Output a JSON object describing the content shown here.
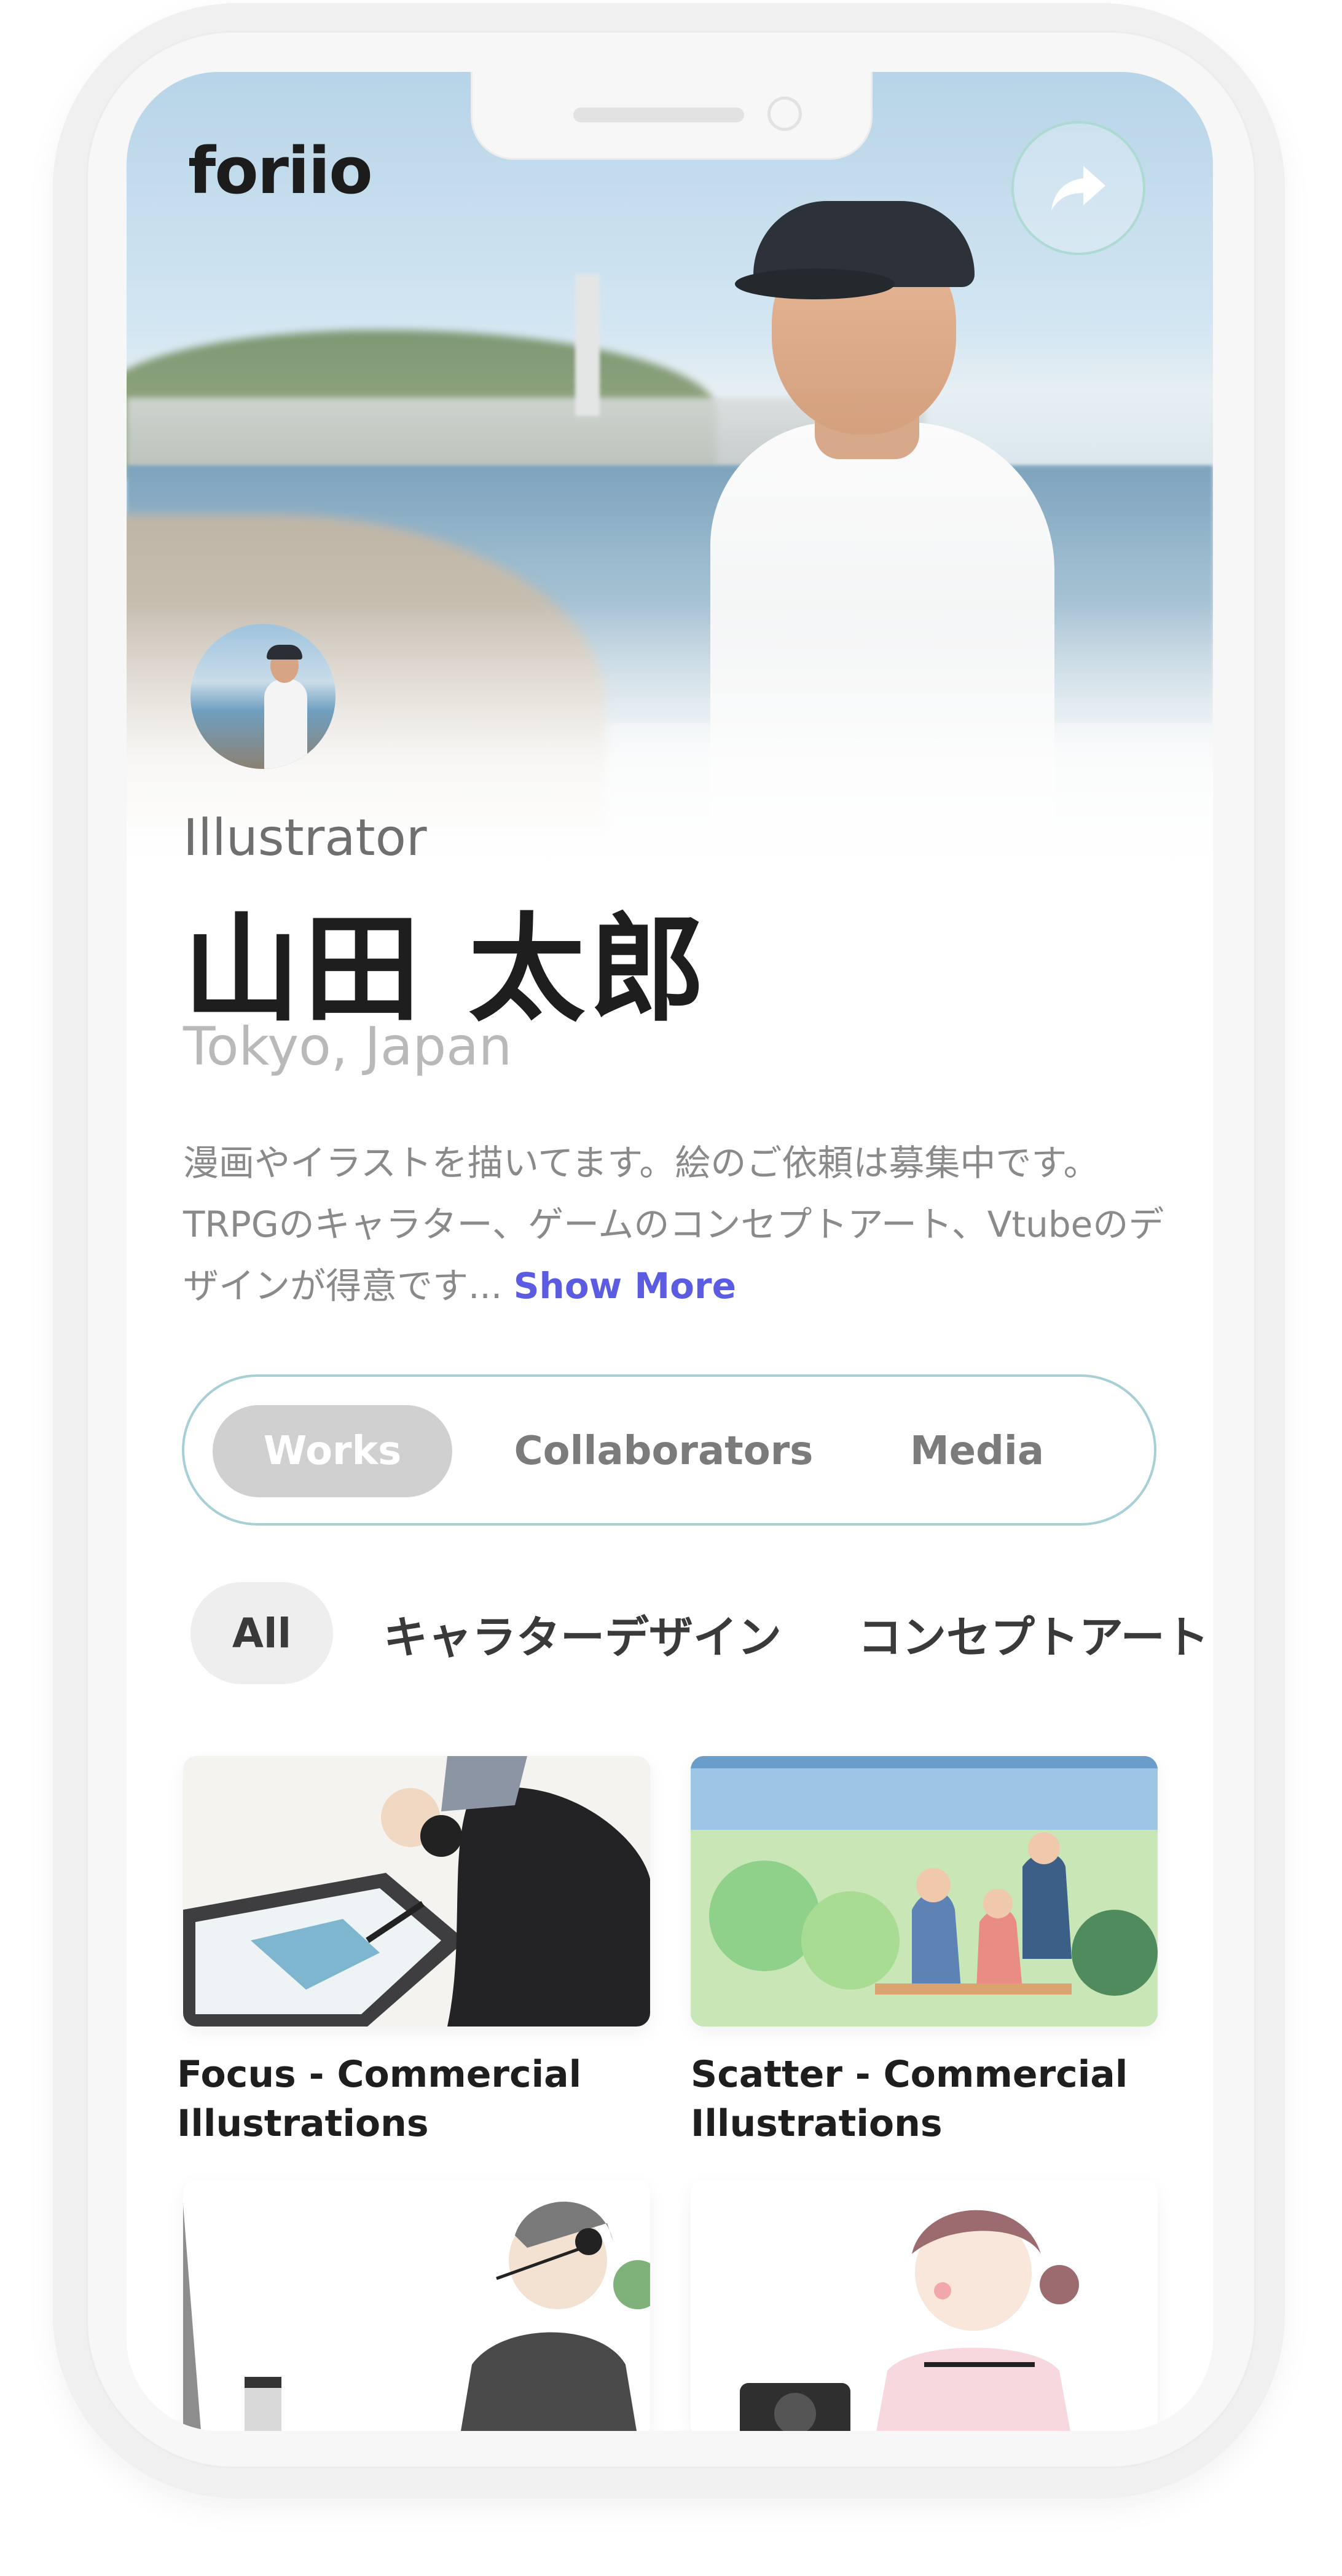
{
  "app": {
    "logo": "foriio"
  },
  "header": {
    "share_icon": "share-arrow-icon"
  },
  "profile": {
    "role": "Illustrator",
    "name": "山田 太郎",
    "location": "Tokyo, Japan",
    "bio": "漫画やイラストを描いてます。絵のご依頼は募集中です。TRPGのキャラター、ゲームのコンセプトアート、Vtubeのデザインが得意です...",
    "show_more": "Show More"
  },
  "tabs": [
    {
      "label": "Works",
      "active": true
    },
    {
      "label": "Collaborators",
      "active": false
    },
    {
      "label": "Media",
      "active": false
    }
  ],
  "categories": [
    {
      "label": "All",
      "active": true
    },
    {
      "label": "キャラターデザイン",
      "active": false
    },
    {
      "label": "コンセプトアート",
      "active": false
    }
  ],
  "works": [
    {
      "title": "Focus - Commercial Illustrations"
    },
    {
      "title": "Scatter - Commercial Illustrations"
    },
    {
      "title": ""
    },
    {
      "title": ""
    }
  ],
  "colors": {
    "accent": "#5b5ce2",
    "tab_border": "#a6cfd6",
    "active_tab": "#d0d0d0",
    "share_ring": "#a8d8ce"
  }
}
